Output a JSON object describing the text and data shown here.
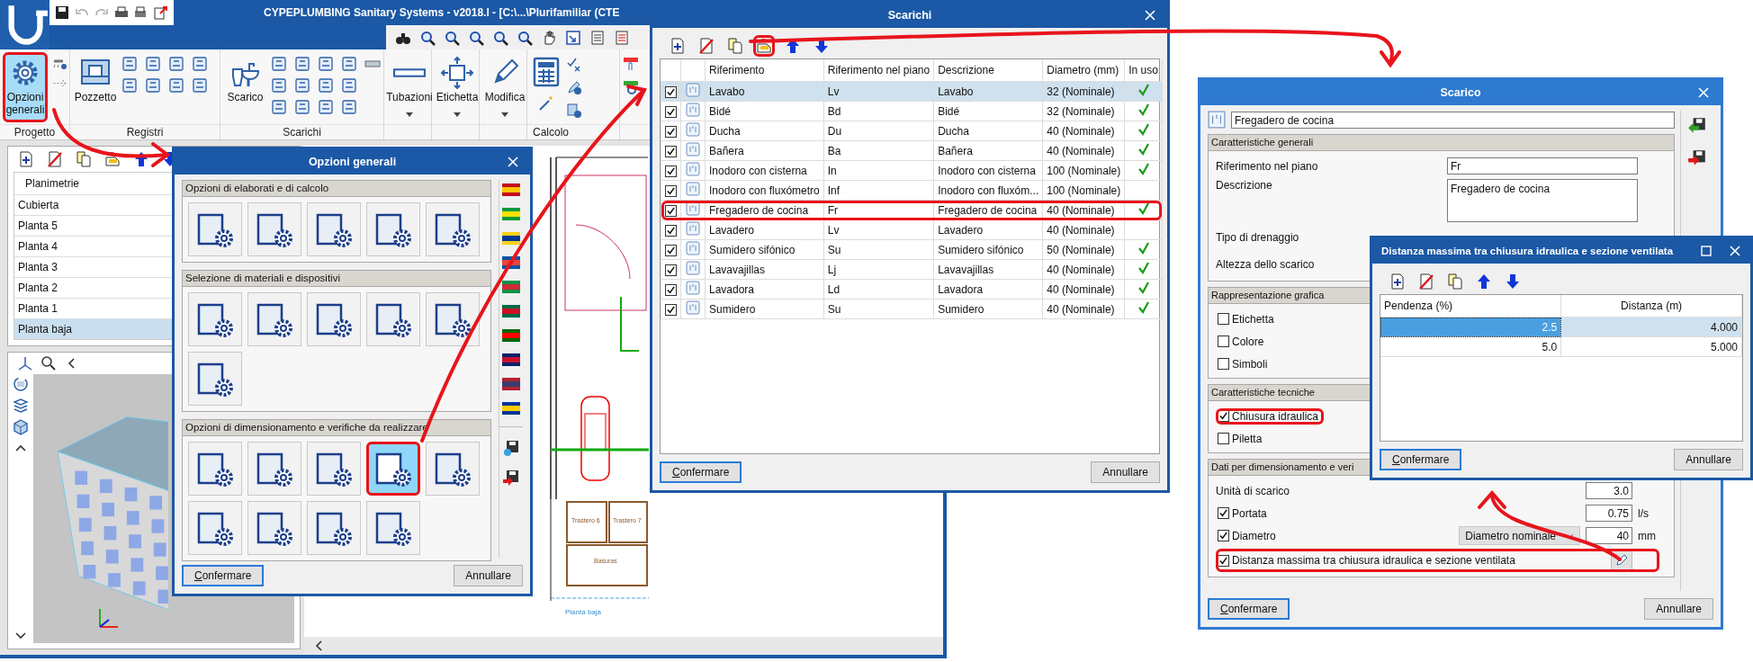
{
  "main_window": {
    "title": "CYPEPLUMBING Sanitary Systems - v2018.l - [C:\\...\\Plurifamiliar (CTE",
    "ribbon": [
      {
        "kind": "project",
        "label": "Progetto",
        "buttons": [
          {
            "kind": "settings",
            "label": "Opzioni generali",
            "selected": true,
            "circled": true
          }
        ]
      },
      {
        "kind": "registers",
        "label": "Registri",
        "buttons": [
          {
            "kind": "manhole",
            "label": "Pozzetto",
            "selected": false,
            "circled": false
          }
        ]
      },
      {
        "kind": "drains",
        "label": "Scarichi",
        "buttons": [
          {
            "kind": "drain",
            "label": "Scarico",
            "selected": false,
            "circled": false
          }
        ]
      },
      {
        "kind": "tool",
        "buttons": [
          {
            "kind": "pipe",
            "label": "Tubazioni",
            "selected": false,
            "circled": false
          }
        ]
      },
      {
        "kind": "tool",
        "buttons": [
          {
            "kind": "label",
            "label": "Etichetta",
            "selected": false,
            "circled": false
          }
        ]
      },
      {
        "kind": "tool",
        "buttons": [
          {
            "kind": "edit",
            "label": "Modifica",
            "selected": false,
            "circled": false
          }
        ]
      },
      {
        "kind": "calc",
        "label": "Calcolo"
      }
    ],
    "list_header": "Planimetrie",
    "levels": [
      {
        "name": "Cubierta",
        "selected": false
      },
      {
        "name": "Planta 5",
        "selected": false
      },
      {
        "name": "Planta 4",
        "selected": false
      },
      {
        "name": "Planta 3",
        "selected": false
      },
      {
        "name": "Planta 2",
        "selected": false
      },
      {
        "name": "Planta 1",
        "selected": false
      },
      {
        "name": "Planta baja",
        "selected": true
      }
    ],
    "plan": {
      "caption": "Planta baja",
      "rooms": [
        "Trastero 6",
        "Trastero 7",
        "Basuras"
      ]
    }
  },
  "options_dialog": {
    "title": "Opzioni generali",
    "sections": [
      {
        "title": "Opzioni di elaborati e di calcolo",
        "tiles": [
          {
            "selected": false,
            "circled": false
          },
          {
            "selected": false,
            "circled": false
          },
          {
            "selected": false,
            "circled": false
          },
          {
            "selected": false,
            "circled": false
          },
          {
            "selected": false,
            "circled": false
          }
        ]
      },
      {
        "title": "Selezione di materiali e dispositivi",
        "tiles": [
          {
            "selected": false,
            "circled": false
          },
          {
            "selected": false,
            "circled": false
          },
          {
            "selected": false,
            "circled": false
          },
          {
            "selected": false,
            "circled": false
          },
          {
            "selected": false,
            "circled": false
          },
          {
            "selected": false,
            "circled": false
          }
        ]
      },
      {
        "title": "Opzioni di dimensionamento e verifiche da realizzare",
        "tiles": [
          {
            "selected": false,
            "circled": false
          },
          {
            "selected": false,
            "circled": false
          },
          {
            "selected": false,
            "circled": false
          },
          {
            "selected": true,
            "circled": true
          },
          {
            "selected": false,
            "circled": false
          },
          {
            "selected": false,
            "circled": false
          },
          {
            "selected": false,
            "circled": false
          },
          {
            "selected": false,
            "circled": false
          },
          {
            "selected": false,
            "circled": false
          }
        ]
      }
    ],
    "buttons": [
      "Confermare",
      "Annullare"
    ]
  },
  "drains_dialog": {
    "title": "Scarichi",
    "toolbar": [
      {
        "kind": "add",
        "circled": false
      },
      {
        "kind": "delete",
        "circled": false
      },
      {
        "kind": "copy",
        "circled": false
      },
      {
        "kind": "edit",
        "circled": true
      },
      {
        "kind": "up",
        "circled": false
      },
      {
        "kind": "down",
        "circled": false
      }
    ],
    "columns": [
      "Riferimento",
      "Riferimento nel piano",
      "Descrizione",
      "Diametro (mm)",
      "In uso"
    ],
    "rows": [
      {
        "checked": true,
        "reference": "Lavabo",
        "plan_ref": "Lv",
        "description": "Lavabo",
        "diameter": "32 (Nominale)",
        "in_use": true,
        "selected": true,
        "circled": false
      },
      {
        "checked": true,
        "reference": "Bidé",
        "plan_ref": "Bd",
        "description": "Bidé",
        "diameter": "32 (Nominale)",
        "in_use": true,
        "selected": false,
        "circled": false
      },
      {
        "checked": true,
        "reference": "Ducha",
        "plan_ref": "Du",
        "description": "Ducha",
        "diameter": "40 (Nominale)",
        "in_use": true,
        "selected": false,
        "circled": false
      },
      {
        "checked": true,
        "reference": "Bañera",
        "plan_ref": "Ba",
        "description": "Bañera",
        "diameter": "40 (Nominale)",
        "in_use": true,
        "selected": false,
        "circled": false
      },
      {
        "checked": true,
        "reference": "Inodoro con cisterna",
        "plan_ref": "In",
        "description": "Inodoro con cisterna",
        "diameter": "100 (Nominale)",
        "in_use": true,
        "selected": false,
        "circled": false
      },
      {
        "checked": true,
        "reference": "Inodoro con fluxómetro",
        "plan_ref": "Inf",
        "description": "Inodoro con fluxóm...",
        "diameter": "100 (Nominale)",
        "in_use": false,
        "selected": false,
        "circled": false
      },
      {
        "checked": true,
        "reference": "Fregadero de cocina",
        "plan_ref": "Fr",
        "description": "Fregadero de cocina",
        "diameter": "40 (Nominale)",
        "in_use": true,
        "selected": false,
        "circled": true
      },
      {
        "checked": true,
        "reference": "Lavadero",
        "plan_ref": "Lv",
        "description": "Lavadero",
        "diameter": "40 (Nominale)",
        "in_use": false,
        "selected": false,
        "circled": false
      },
      {
        "checked": true,
        "reference": "Sumidero sifónico",
        "plan_ref": "Su",
        "description": "Sumidero sifónico",
        "diameter": "50 (Nominale)",
        "in_use": true,
        "selected": false,
        "circled": false
      },
      {
        "checked": true,
        "reference": "Lavavajillas",
        "plan_ref": "Lj",
        "description": "Lavavajillas",
        "diameter": "40 (Nominale)",
        "in_use": true,
        "selected": false,
        "circled": false
      },
      {
        "checked": true,
        "reference": "Lavadora",
        "plan_ref": "Ld",
        "description": "Lavadora",
        "diameter": "40 (Nominale)",
        "in_use": true,
        "selected": false,
        "circled": false
      },
      {
        "checked": true,
        "reference": "Sumidero",
        "plan_ref": "Su",
        "description": "Sumidero",
        "diameter": "40 (Nominale)",
        "in_use": true,
        "selected": false,
        "circled": false
      }
    ],
    "buttons": [
      "Confermare",
      "Annullare"
    ]
  },
  "drain_dialog": {
    "title": "Scarico",
    "name": "Fregadero de cocina",
    "sections": [
      {
        "title": "Caratteristiche generali",
        "rows": [
          {
            "kind": "text",
            "label": "Riferimento nel piano",
            "value": "Fr"
          },
          {
            "kind": "textarea",
            "label": "Descrizione",
            "value": "Fregadero de cocina"
          },
          {
            "kind": "label",
            "label": "Tipo di drenaggio"
          },
          {
            "kind": "label",
            "label": "Altezza dello scarico"
          }
        ]
      },
      {
        "title": "Rappresentazione grafica",
        "rows": [
          {
            "kind": "check",
            "label": "Etichetta",
            "checked": false,
            "circled": false
          },
          {
            "kind": "check",
            "label": "Colore",
            "checked": false,
            "circled": false
          },
          {
            "kind": "check",
            "label": "Simboli",
            "checked": false,
            "circled": false
          }
        ]
      },
      {
        "title": "Caratteristiche tecniche",
        "rows": [
          {
            "kind": "check",
            "label": "Chiusura idraulica",
            "checked": true,
            "circled": true
          },
          {
            "kind": "check",
            "label": "Piletta",
            "checked": false,
            "circled": false
          }
        ]
      },
      {
        "title": "Dati per dimensionamento e veri",
        "rows": [
          {
            "kind": "number",
            "label": "Unità di scarico",
            "value": "3.0"
          },
          {
            "kind": "check_number",
            "label": "Portata",
            "checked": true,
            "value": "0.75",
            "unit": "l/s"
          },
          {
            "kind": "check_select_number",
            "label": "Diametro",
            "checked": true,
            "select": "Diametro nominale",
            "value": "40",
            "unit": "mm"
          },
          {
            "kind": "check_edit",
            "label": "Distanza massima tra chiusura idraulica e sezione ventilata",
            "checked": true,
            "circled": true
          }
        ]
      }
    ],
    "buttons": [
      "Confermare",
      "Annullare"
    ]
  },
  "distance_dialog": {
    "title": "Distanza massima tra chiusura idraulica e sezione ventilata",
    "columns": [
      "Pendenza (%)",
      "Distanza (m)"
    ],
    "rows": [
      {
        "slope": "2.5",
        "distance": "4.000",
        "selected": true
      },
      {
        "slope": "5.0",
        "distance": "5.000",
        "selected": false
      }
    ],
    "buttons": [
      "Confermare",
      "Annullare"
    ]
  }
}
